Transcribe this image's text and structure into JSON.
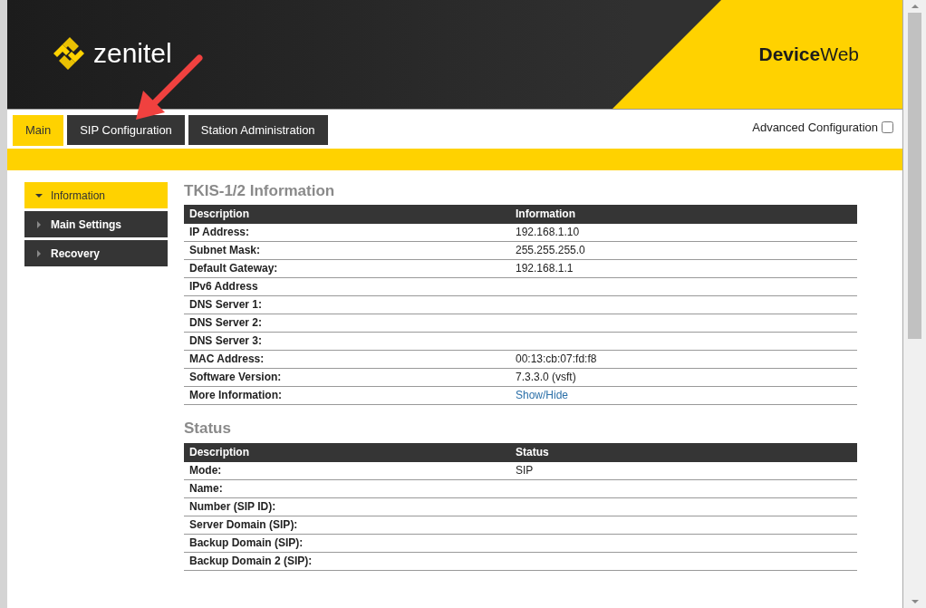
{
  "header": {
    "logo_text": "zenitel",
    "product": "**Device**Web"
  },
  "tabs": [
    {
      "label": "Main",
      "selected": true
    },
    {
      "label": "SIP Configuration",
      "selected": false
    },
    {
      "label": "Station Administration",
      "selected": false
    }
  ],
  "advanced_configuration": {
    "label": "Advanced Configuration",
    "checked": false
  },
  "sidebar": {
    "items": [
      {
        "label": "Information",
        "selected": true,
        "expanded": true
      },
      {
        "label": "Main Settings",
        "selected": false,
        "expanded": false
      },
      {
        "label": "Recovery",
        "selected": false,
        "expanded": false
      }
    ]
  },
  "sections": [
    {
      "title": "TKIS-1/2 Information",
      "columns": [
        "Description",
        "Information"
      ],
      "rows": [
        {
          "description": "IP Address:",
          "value": "192.168.1.10",
          "kind": "text"
        },
        {
          "description": "Subnet Mask:",
          "value": "255.255.255.0",
          "kind": "text"
        },
        {
          "description": "Default Gateway:",
          "value": "192.168.1.1",
          "kind": "text"
        },
        {
          "description": "IPv6 Address",
          "kind": "text"
        },
        {
          "description": "DNS Server 1:",
          "kind": "text"
        },
        {
          "description": "DNS Server 2:",
          "kind": "text"
        },
        {
          "description": "DNS Server 3:",
          "kind": "text"
        },
        {
          "description": "MAC Address:",
          "value": "00:13:cb:07:fd:f8",
          "kind": "text"
        },
        {
          "description": "Software Version:",
          "value": "7.3.3.0 (vsft)",
          "kind": "text"
        },
        {
          "description": "More Information:",
          "value": "Show/Hide",
          "kind": "link"
        }
      ]
    },
    {
      "title": "Status",
      "columns": [
        "Description",
        "Status"
      ],
      "rows": [
        {
          "description": "Mode:",
          "value": "SIP",
          "kind": "text"
        },
        {
          "description": "Name:",
          "kind": "text"
        },
        {
          "description": "Number (SIP ID):",
          "kind": "text"
        },
        {
          "description": "Server Domain (SIP):",
          "kind": "text"
        },
        {
          "description": "Backup Domain (SIP):",
          "kind": "text"
        },
        {
          "description": "Backup Domain 2 (SIP):",
          "kind": "text"
        }
      ]
    }
  ]
}
